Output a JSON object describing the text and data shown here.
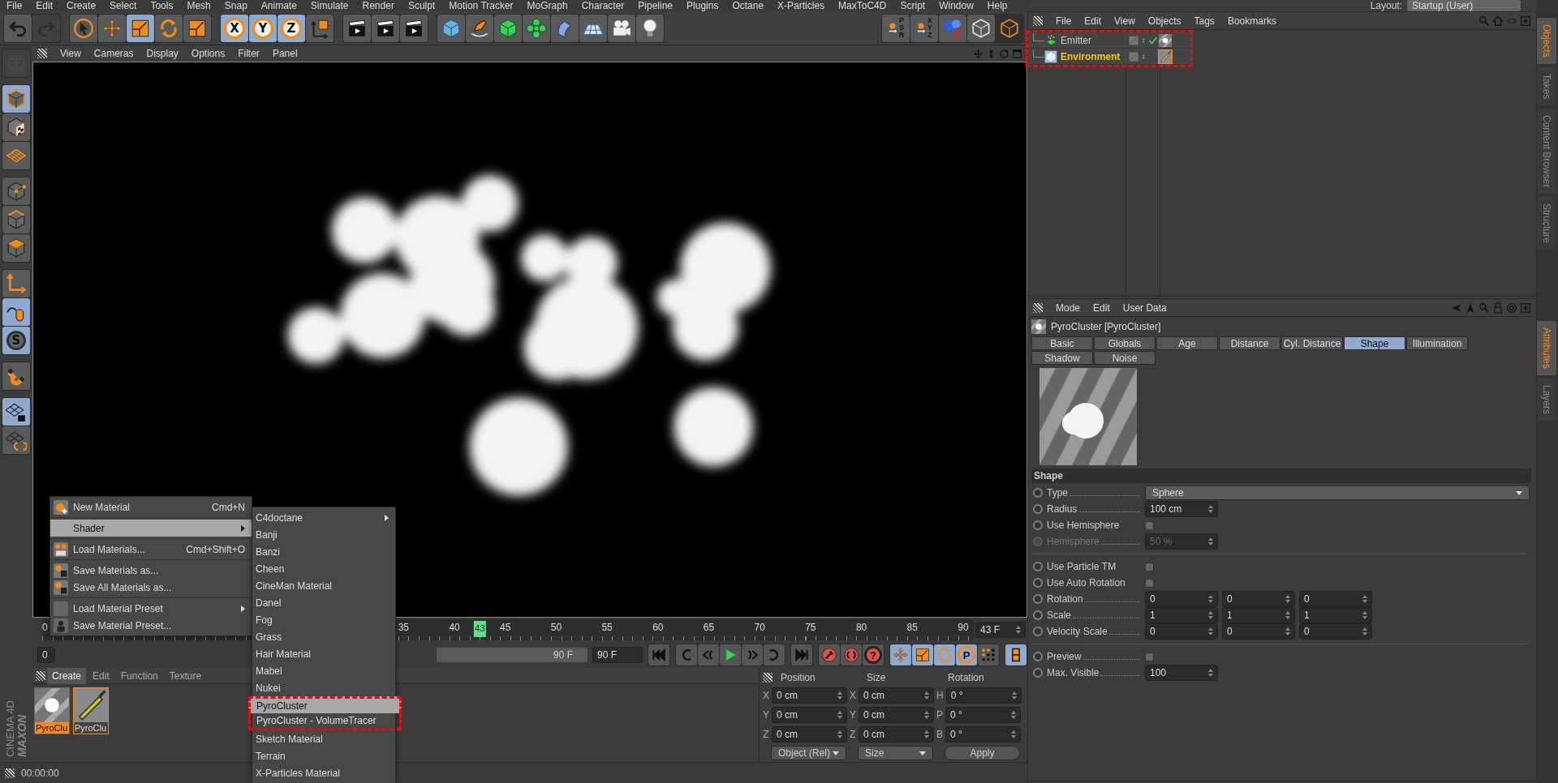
{
  "menu_bar": [
    "File",
    "Edit",
    "Create",
    "Select",
    "Tools",
    "Mesh",
    "Snap",
    "Animate",
    "Simulate",
    "Render",
    "Sculpt",
    "Motion Tracker",
    "MoGraph",
    "Character",
    "Pipeline",
    "Plugins",
    "Octane",
    "X-Particles",
    "MaxToC4D",
    "Script",
    "Window",
    "Help"
  ],
  "layout": {
    "label": "Layout:",
    "value": "Startup (User)"
  },
  "toolbar": [
    [
      {
        "kind": "undo",
        "selected": false,
        "disabled": false
      },
      {
        "kind": "redo",
        "selected": false,
        "disabled": true
      }
    ],
    [
      {
        "kind": "pointer",
        "selected": false,
        "disabled": false
      },
      {
        "kind": "move",
        "selected": false,
        "disabled": false
      },
      {
        "kind": "scale",
        "selected": true,
        "disabled": false
      },
      {
        "kind": "rotate",
        "selected": false,
        "disabled": false
      },
      {
        "kind": "scale",
        "selected": false,
        "disabled": false
      }
    ],
    [
      {
        "kind": "axis",
        "label": "X",
        "selected": true,
        "disabled": false
      },
      {
        "kind": "axis",
        "label": "Y",
        "selected": true,
        "disabled": false
      },
      {
        "kind": "axis",
        "label": "Z",
        "selected": true,
        "disabled": false
      },
      {
        "kind": "coords",
        "selected": false,
        "disabled": false
      }
    ],
    [
      {
        "kind": "clapper",
        "selected": false,
        "disabled": false
      },
      {
        "kind": "clapper",
        "selected": false,
        "disabled": false
      },
      {
        "kind": "clapper",
        "selected": false,
        "disabled": false
      }
    ],
    [
      {
        "kind": "cube",
        "selected": false,
        "disabled": false
      },
      {
        "kind": "pen",
        "selected": false,
        "disabled": false
      },
      {
        "kind": "subdiv",
        "selected": false,
        "disabled": false
      },
      {
        "kind": "cloner",
        "selected": false,
        "disabled": false
      },
      {
        "kind": "deformer",
        "selected": false,
        "disabled": false
      },
      {
        "kind": "floor",
        "selected": false,
        "disabled": false
      },
      {
        "kind": "camera",
        "selected": false,
        "disabled": false
      },
      {
        "kind": "light",
        "selected": false,
        "disabled": false
      }
    ]
  ],
  "toolbar_right": [
    {
      "kind": "lock",
      "label": "PSR",
      "selected": false
    },
    {
      "kind": "lock",
      "label": "XYZ",
      "selected": false
    },
    {
      "kind": "sphere-drop",
      "selected": false
    },
    {
      "kind": "display",
      "selected": false
    },
    {
      "kind": "display",
      "selected": true
    }
  ],
  "left_tools": [
    [
      {
        "kind": "model",
        "selected": false,
        "disabled": true
      }
    ],
    [
      {
        "kind": "object",
        "selected": true,
        "disabled": false
      },
      {
        "kind": "texture",
        "selected": false,
        "disabled": false
      },
      {
        "kind": "workplane",
        "selected": false,
        "disabled": false
      }
    ],
    [
      {
        "kind": "points",
        "selected": false,
        "disabled": false
      },
      {
        "kind": "edges",
        "selected": false,
        "disabled": false
      },
      {
        "kind": "polygons",
        "selected": false,
        "disabled": false
      }
    ],
    [
      {
        "kind": "axis-arrows",
        "selected": false,
        "disabled": false
      },
      {
        "kind": "tweak",
        "selected": true,
        "disabled": false
      },
      {
        "kind": "solo",
        "label": "S",
        "selected": true,
        "disabled": false
      }
    ],
    [
      {
        "kind": "snap",
        "selected": false,
        "disabled": false
      }
    ],
    [
      {
        "kind": "lock-plane",
        "selected": true,
        "disabled": false
      },
      {
        "kind": "sync-plane",
        "selected": false,
        "disabled": false
      }
    ]
  ],
  "viewport": {
    "menu": [
      "View",
      "Cameras",
      "Display",
      "Options",
      "Filter",
      "Panel"
    ]
  },
  "timeline": {
    "first_tick": "0",
    "ticks": [
      "35",
      "40",
      "45",
      "50",
      "55",
      "60",
      "65",
      "70",
      "75",
      "80",
      "85",
      "90"
    ],
    "playhead": {
      "label": "43",
      "level": 0.478
    },
    "frame_field": "43 F"
  },
  "transport": {
    "start_field": "0",
    "range": {
      "end": "90 F",
      "level": 1
    },
    "end_field": "90 F",
    "groups": [
      [
        {
          "kind": "first",
          "selected": false
        }
      ],
      [
        {
          "kind": "prev-key",
          "selected": false
        },
        {
          "kind": "prev",
          "selected": false
        },
        {
          "kind": "play",
          "selected": false
        },
        {
          "kind": "next",
          "selected": false
        },
        {
          "kind": "next-key",
          "selected": false
        }
      ],
      [
        {
          "kind": "last",
          "selected": false
        }
      ],
      [
        {
          "kind": "record",
          "selected": false
        },
        {
          "kind": "autokey",
          "selected": false
        },
        {
          "kind": "keysel",
          "label": "?",
          "selected": false
        }
      ],
      [
        {
          "kind": "move",
          "selected": true
        },
        {
          "kind": "scale",
          "selected": true
        },
        {
          "kind": "rotate",
          "selected": true
        },
        {
          "kind": "param",
          "label": "P",
          "selected": true
        },
        {
          "kind": "dots",
          "selected": false
        }
      ],
      [
        {
          "kind": "film",
          "selected": true
        }
      ]
    ]
  },
  "materials": {
    "menu": [
      {
        "label": "Create",
        "selected": true
      },
      {
        "label": "Edit",
        "selected": false
      },
      {
        "label": "Function",
        "selected": false
      },
      {
        "label": "Texture",
        "selected": false
      }
    ],
    "items": [
      {
        "name": "PyroClu",
        "kind": "smoke",
        "selected": true,
        "active": false
      },
      {
        "name": "PyroClu",
        "kind": "volume",
        "selected": false,
        "active": true
      }
    ]
  },
  "coordinates": {
    "headers": [
      "Position",
      "Size",
      "Rotation"
    ],
    "rows": [
      [
        {
          "axis": "X",
          "value": "0 cm"
        },
        {
          "axis": "X",
          "value": "0 cm"
        },
        {
          "axis": "H",
          "value": "0 °"
        }
      ],
      [
        {
          "axis": "Y",
          "value": "0 cm"
        },
        {
          "axis": "Y",
          "value": "0 cm"
        },
        {
          "axis": "P",
          "value": "0 °"
        }
      ],
      [
        {
          "axis": "Z",
          "value": "0 cm"
        },
        {
          "axis": "Z",
          "value": "0 cm"
        },
        {
          "axis": "B",
          "value": "0 °"
        }
      ]
    ],
    "dropdowns": [
      "Object (Rel)",
      "Size"
    ],
    "apply": "Apply"
  },
  "status_bar": {
    "time": "00:00:00"
  },
  "logo": {
    "brand": "MAXON",
    "product": "CINEMA 4D"
  },
  "context_menu": [
    {
      "kind": "new",
      "label": "New Material",
      "shortcut": "Cmd+N",
      "submenu": false,
      "selected": false
    },
    {
      "kind": "separator"
    },
    {
      "kind": "plain",
      "label": "Shader",
      "submenu": true,
      "selected": true
    },
    {
      "kind": "separator"
    },
    {
      "kind": "load",
      "label": "Load Materials...",
      "shortcut": "Cmd+Shift+O",
      "submenu": false,
      "selected": false
    },
    {
      "kind": "separator"
    },
    {
      "kind": "save",
      "label": "Save Materials as...",
      "submenu": false,
      "selected": false
    },
    {
      "kind": "save",
      "label": "Save All Materials as...",
      "submenu": false,
      "selected": false
    },
    {
      "kind": "separator"
    },
    {
      "kind": "preset",
      "label": "Load Material Preset",
      "submenu": true,
      "selected": false
    },
    {
      "kind": "preset-save",
      "label": "Save Material Preset...",
      "submenu": false,
      "selected": false
    }
  ],
  "submenu": [
    {
      "label": "C4doctane",
      "submenu": true,
      "selected": false,
      "annotated": false
    },
    {
      "label": "Banji",
      "submenu": false,
      "selected": false,
      "annotated": false
    },
    {
      "label": "Banzi",
      "submenu": false,
      "selected": false,
      "annotated": false
    },
    {
      "label": "Cheen",
      "submenu": false,
      "selected": false,
      "annotated": false
    },
    {
      "label": "CineMan Material",
      "submenu": false,
      "selected": false,
      "annotated": false
    },
    {
      "label": "Danel",
      "submenu": false,
      "selected": false,
      "annotated": false
    },
    {
      "label": "Fog",
      "submenu": false,
      "selected": false,
      "annotated": false
    },
    {
      "label": "Grass",
      "submenu": false,
      "selected": false,
      "annotated": false
    },
    {
      "label": "Hair Material",
      "submenu": false,
      "selected": false,
      "annotated": false
    },
    {
      "label": "Mabel",
      "submenu": false,
      "selected": false,
      "annotated": false
    },
    {
      "label": "Nukei",
      "submenu": false,
      "selected": false,
      "annotated": false
    },
    {
      "label": "PyroCluster",
      "submenu": false,
      "selected": true,
      "annotated": true
    },
    {
      "label": "PyroCluster - VolumeTracer",
      "submenu": false,
      "selected": false,
      "annotated": true
    },
    {
      "label": "Sketch Material",
      "submenu": false,
      "selected": false,
      "annotated": false
    },
    {
      "label": "Terrain",
      "submenu": false,
      "selected": false,
      "annotated": false
    },
    {
      "label": "X-Particles Material",
      "submenu": false,
      "selected": false,
      "annotated": false
    }
  ],
  "objects": {
    "menu": [
      "File",
      "Edit",
      "View",
      "Objects",
      "Tags",
      "Bookmarks"
    ],
    "annotated": true,
    "rows": [
      {
        "name": "Emitter",
        "kind": "emitter",
        "selected": false,
        "enabled": true,
        "tags": [
          {
            "kind": "smoke",
            "selected": false
          }
        ]
      },
      {
        "name": "Environment",
        "kind": "environment",
        "selected": true,
        "enabled": false,
        "tags": [
          {
            "kind": "brush",
            "selected": true
          }
        ]
      }
    ]
  },
  "attributes": {
    "menu": [
      "Mode",
      "Edit",
      "User Data"
    ],
    "title": "PyroCluster [PyroCluster]",
    "tabs": [
      {
        "label": "Basic",
        "selected": false
      },
      {
        "label": "Globals",
        "selected": false
      },
      {
        "label": "Age",
        "selected": false
      },
      {
        "label": "Distance",
        "selected": false
      },
      {
        "label": "Cyl. Distance",
        "selected": false
      },
      {
        "label": "Shape",
        "selected": true
      },
      {
        "label": "Illumination",
        "selected": false
      },
      {
        "label": "Shadow",
        "selected": false
      },
      {
        "label": "Noise",
        "selected": false
      }
    ],
    "section": "Shape",
    "fields": [
      {
        "kind": "dropdown",
        "label": "Type",
        "value": "Sphere",
        "disabled": false
      },
      {
        "kind": "number",
        "label": "Radius",
        "value": "100 cm",
        "disabled": false
      },
      {
        "kind": "checkbox",
        "label": "Use Hemisphere",
        "checked": false,
        "disabled": false
      },
      {
        "kind": "number",
        "label": "Hemisphere",
        "value": "50 %",
        "disabled": true
      },
      {
        "kind": "separator"
      },
      {
        "kind": "checkbox",
        "label": "Use Particle TM",
        "checked": false,
        "disabled": false
      },
      {
        "kind": "checkbox",
        "label": "Use Auto Rotation",
        "checked": false,
        "disabled": false
      },
      {
        "kind": "triple",
        "label": "Rotation",
        "values": [
          "0",
          "0",
          "0"
        ],
        "disabled": false
      },
      {
        "kind": "triple",
        "label": "Scale",
        "values": [
          "1",
          "1",
          "1"
        ],
        "disabled": false
      },
      {
        "kind": "triple",
        "label": "Velocity Scale",
        "values": [
          "0",
          "0",
          "0"
        ],
        "disabled": false
      },
      {
        "kind": "separator"
      },
      {
        "kind": "checkbox",
        "label": "Preview",
        "checked": false,
        "disabled": false
      },
      {
        "kind": "number",
        "label": "Max. Visible",
        "value": "100",
        "disabled": false
      }
    ]
  },
  "side_tabs": {
    "top": [
      {
        "label": "Objects",
        "selected": true
      },
      {
        "label": "Takes",
        "selected": false
      },
      {
        "label": "Content Browser",
        "selected": false
      },
      {
        "label": "Structure",
        "selected": false
      }
    ],
    "bottom": [
      {
        "label": "Attributes",
        "selected": true
      },
      {
        "label": "Layers",
        "selected": false
      }
    ]
  }
}
